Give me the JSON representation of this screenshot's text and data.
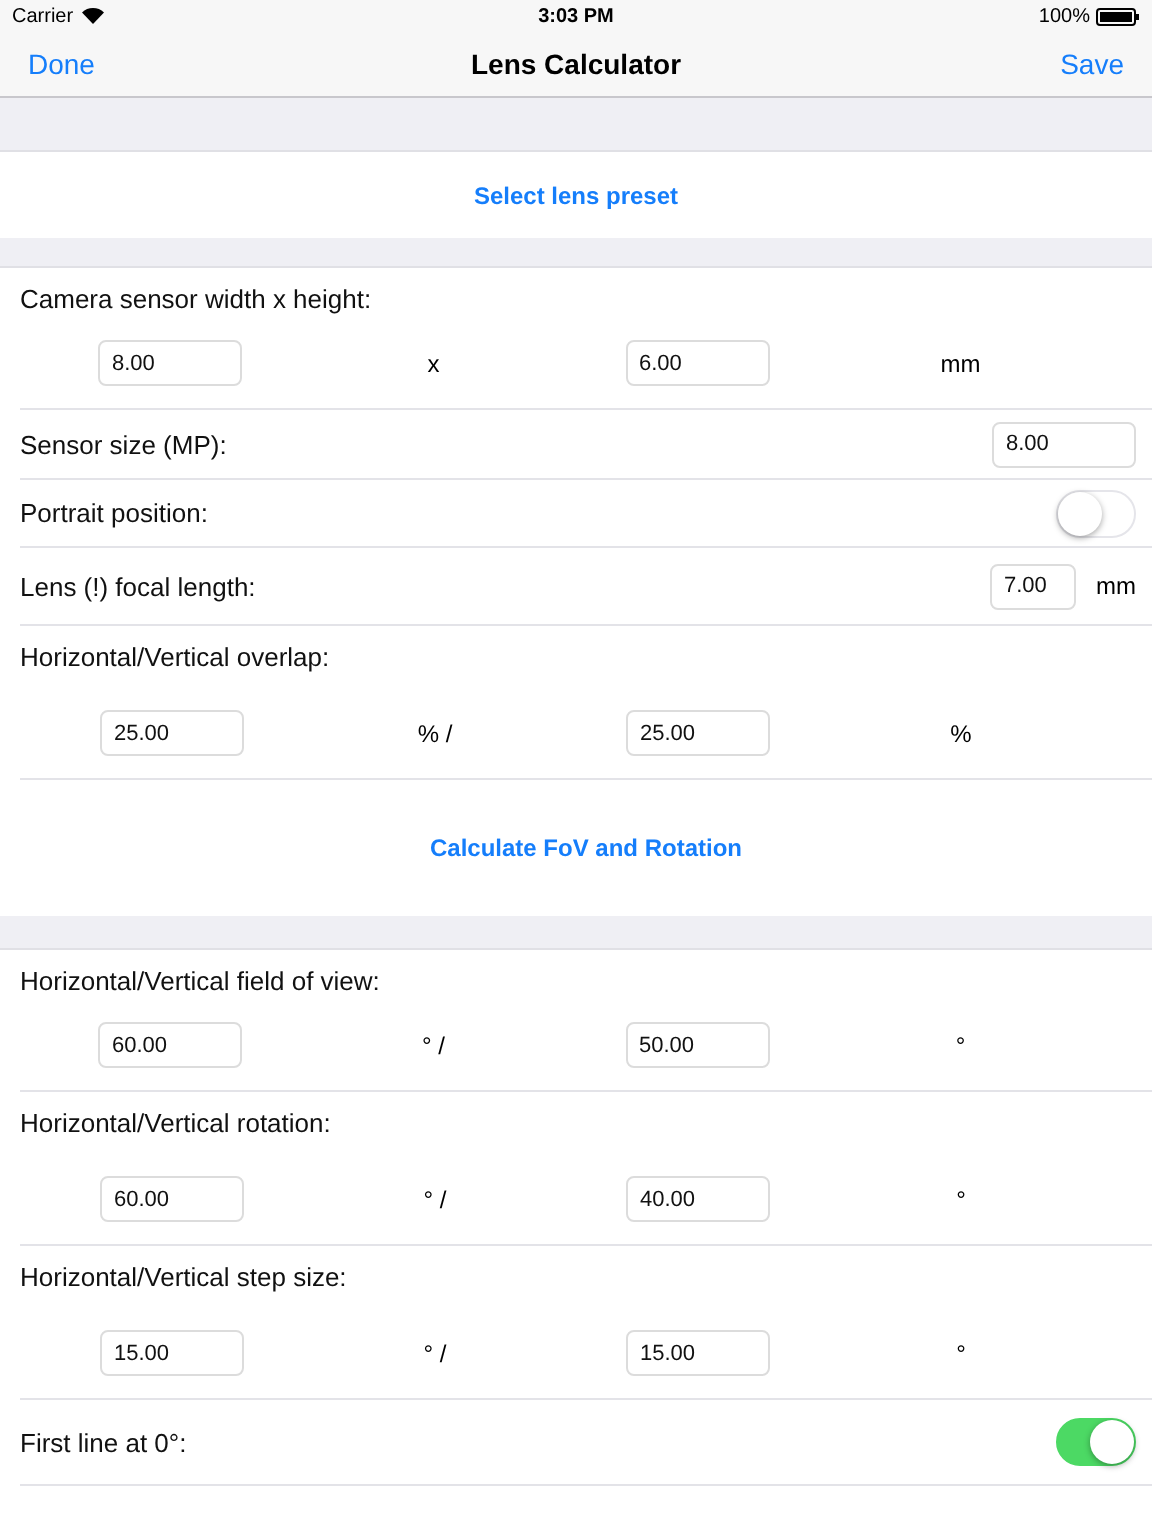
{
  "status_bar": {
    "carrier": "Carrier",
    "time": "3:03 PM",
    "battery": "100%"
  },
  "nav": {
    "left": "Done",
    "title": "Lens Calculator",
    "right": "Save"
  },
  "preset_button": "Select lens preset",
  "sections": [
    {
      "rows": [
        {
          "kind": "pair",
          "label": "Camera sensor width x height:",
          "first": "8.00",
          "separator": "x",
          "second": "6.00",
          "unit": "mm"
        },
        {
          "kind": "field",
          "label": "Sensor size (MP):",
          "value": "8.00"
        },
        {
          "kind": "toggle",
          "label": "Portrait position:",
          "on": false
        },
        {
          "kind": "field",
          "label": "Lens (!) focal length:",
          "value": "7.00",
          "unit": "mm"
        },
        {
          "kind": "pair",
          "label": "Horizontal/Vertical overlap:",
          "first": "25.00",
          "separator": "% /",
          "second": "25.00",
          "unit": "%"
        },
        {
          "kind": "button",
          "label": "Calculate FoV and Rotation"
        }
      ]
    },
    {
      "rows": [
        {
          "kind": "pair",
          "label": "Horizontal/Vertical field of view:",
          "first": "60.00",
          "separator": "° /",
          "second": "50.00",
          "unit": "°"
        },
        {
          "kind": "pair",
          "label": "Horizontal/Vertical rotation:",
          "first": "60.00",
          "separator": "° /",
          "second": "40.00",
          "unit": "°"
        },
        {
          "kind": "pair",
          "label": "Horizontal/Vertical step size:",
          "first": "15.00",
          "separator": "° /",
          "second": "15.00",
          "unit": "°"
        },
        {
          "kind": "toggle",
          "label": "First line at 0°:",
          "on": true
        }
      ]
    }
  ]
}
